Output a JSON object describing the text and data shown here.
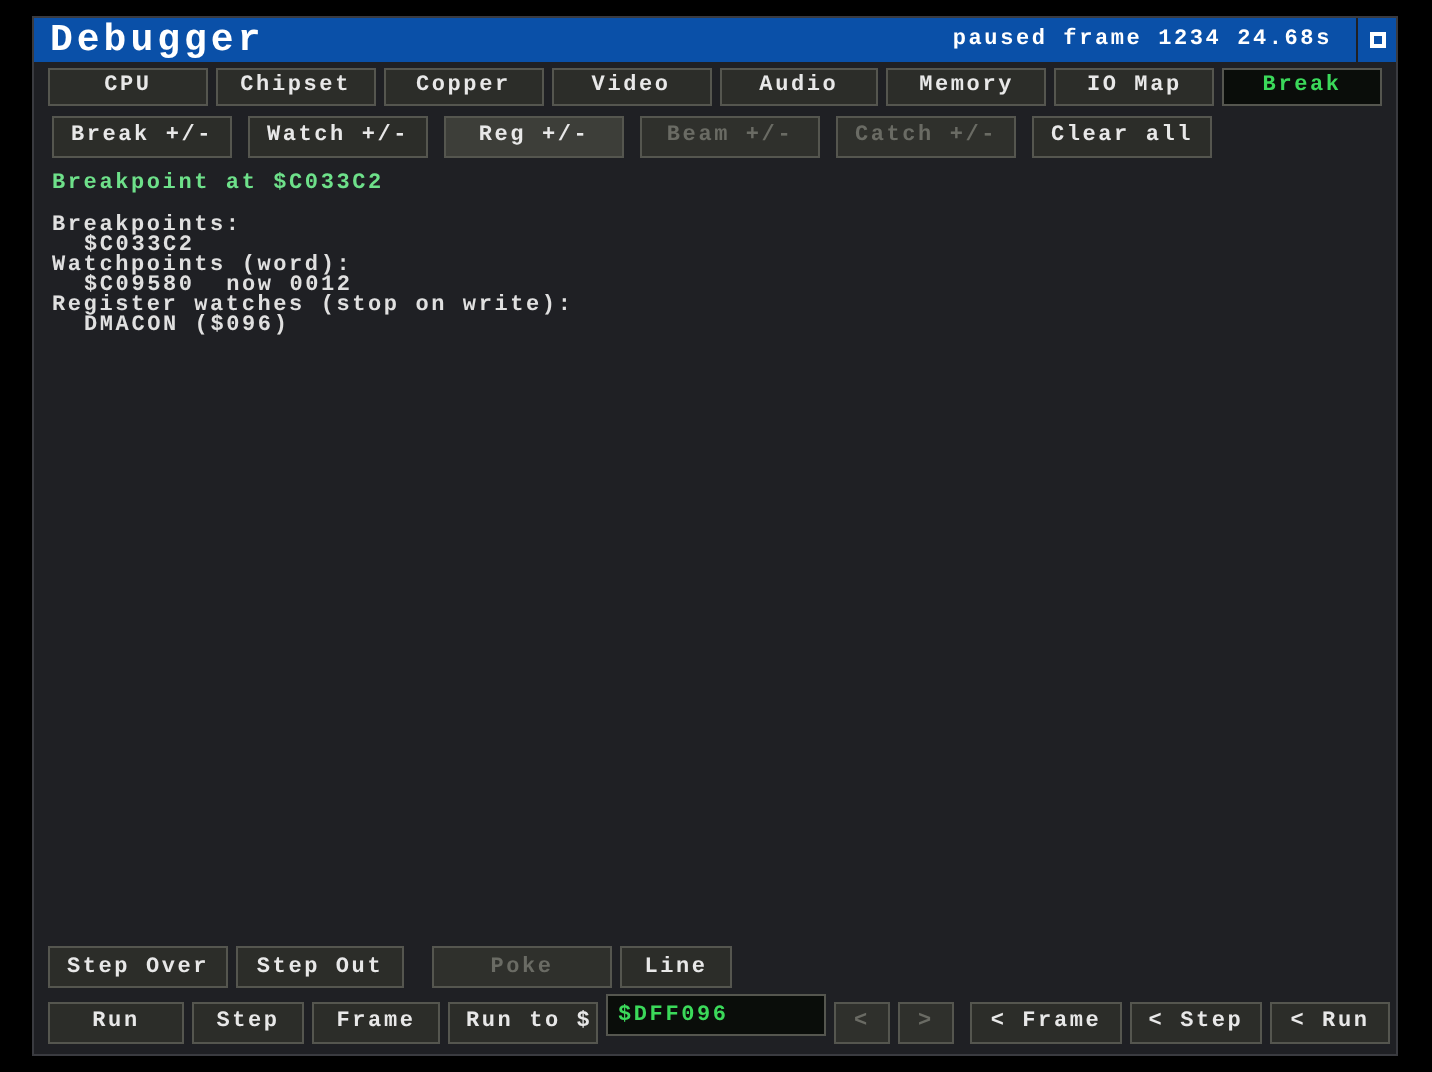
{
  "window": {
    "title": "Debugger",
    "status": "paused frame 1234 24.68s"
  },
  "tabs": [
    {
      "label": "CPU",
      "selected": false
    },
    {
      "label": "Chipset",
      "selected": false
    },
    {
      "label": "Copper",
      "selected": false
    },
    {
      "label": "Video",
      "selected": false
    },
    {
      "label": "Audio",
      "selected": false
    },
    {
      "label": "Memory",
      "selected": false
    },
    {
      "label": "IO Map",
      "selected": false
    },
    {
      "label": "Break",
      "selected": true
    }
  ],
  "toolbar": [
    {
      "label": "Break +/-",
      "disabled": false,
      "active": false
    },
    {
      "label": "Watch +/-",
      "disabled": false,
      "active": false
    },
    {
      "label": "Reg +/-",
      "disabled": false,
      "active": true
    },
    {
      "label": "Beam +/-",
      "disabled": true,
      "active": false
    },
    {
      "label": "Catch +/-",
      "disabled": true,
      "active": false
    },
    {
      "label": "Clear all",
      "disabled": false,
      "active": false
    }
  ],
  "status_message": "Breakpoint at $C033C2",
  "sections": [
    {
      "heading": "Breakpoints:",
      "children": [
        "$C033C2"
      ]
    },
    {
      "heading": "Watchpoints (word):",
      "children": [
        "$C09580  now 0012"
      ]
    },
    {
      "heading": "Register watches (stop on write):",
      "children": [
        "DMACON ($096)"
      ]
    }
  ],
  "bottom_row_1": [
    {
      "label": "Step Over",
      "disabled": false
    },
    {
      "label": "Step Out",
      "disabled": false
    },
    {
      "label": "Poke",
      "disabled": true
    },
    {
      "label": "Line",
      "disabled": false
    }
  ],
  "bottom_row_2": [
    {
      "kind": "button",
      "label": "Run",
      "disabled": false
    },
    {
      "kind": "button",
      "label": "Step",
      "disabled": false
    },
    {
      "kind": "button",
      "label": "Frame",
      "disabled": false
    },
    {
      "kind": "button",
      "label": "Run to $",
      "disabled": false
    },
    {
      "kind": "field",
      "value": "$DFF096"
    },
    {
      "kind": "button",
      "label": "<",
      "disabled": true
    },
    {
      "kind": "button",
      "label": ">",
      "disabled": true
    },
    {
      "kind": "button",
      "label": "< Frame",
      "disabled": false
    },
    {
      "kind": "button",
      "label": "< Step",
      "disabled": false
    },
    {
      "kind": "button",
      "label": "< Run",
      "disabled": false
    }
  ]
}
